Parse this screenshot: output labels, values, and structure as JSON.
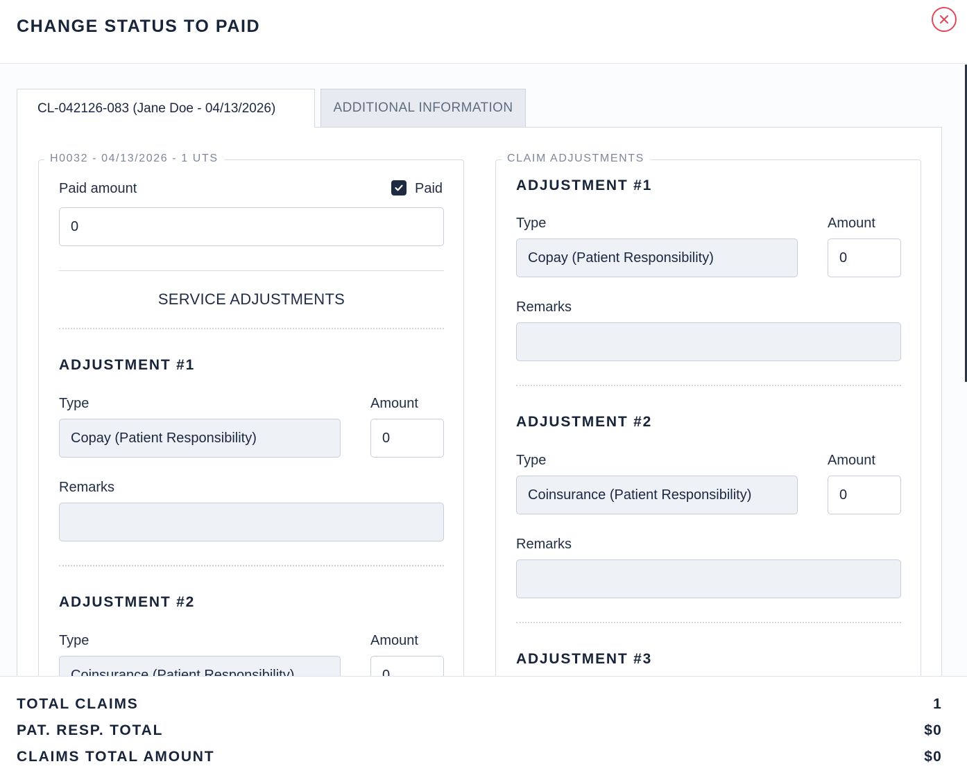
{
  "dialog": {
    "title": "CHANGE STATUS TO PAID"
  },
  "tabs": [
    {
      "label": "CL-042126-083 (Jane Doe - 04/13/2026)",
      "active": true
    },
    {
      "label": "ADDITIONAL INFORMATION",
      "active": false
    }
  ],
  "service": {
    "legend": "H0032 - 04/13/2026 - 1 UTS",
    "paid_amount_label": "Paid amount",
    "paid_amount_value": "0",
    "paid_checkbox_label": "Paid",
    "paid_checked": true,
    "adjustments_heading": "SERVICE ADJUSTMENTS",
    "adjustments": [
      {
        "title": "ADJUSTMENT #1",
        "type_label": "Type",
        "type_value": "Copay (Patient Responsibility)",
        "amount_label": "Amount",
        "amount_value": "0",
        "remarks_label": "Remarks",
        "remarks_value": ""
      },
      {
        "title": "ADJUSTMENT #2",
        "type_label": "Type",
        "type_value": "Coinsurance (Patient Responsibility)",
        "amount_label": "Amount",
        "amount_value": "0"
      }
    ]
  },
  "claim": {
    "legend": "CLAIM ADJUSTMENTS",
    "adjustments": [
      {
        "title": "ADJUSTMENT #1",
        "type_label": "Type",
        "type_value": "Copay (Patient Responsibility)",
        "amount_label": "Amount",
        "amount_value": "0",
        "remarks_label": "Remarks",
        "remarks_value": ""
      },
      {
        "title": "ADJUSTMENT #2",
        "type_label": "Type",
        "type_value": "Coinsurance (Patient Responsibility)",
        "amount_label": "Amount",
        "amount_value": "0",
        "remarks_label": "Remarks",
        "remarks_value": ""
      },
      {
        "title": "ADJUSTMENT #3"
      }
    ]
  },
  "summary": [
    {
      "label": "TOTAL CLAIMS",
      "value": "1"
    },
    {
      "label": "PAT. RESP. TOTAL",
      "value": "$0"
    },
    {
      "label": "CLAIMS TOTAL AMOUNT",
      "value": "$0"
    }
  ],
  "colors": {
    "close_icon": "#e0485a",
    "checkbox_fill": "#1d2a40",
    "grey_input": "#eef1f6"
  },
  "icons": {
    "close": "close-icon",
    "check": "check-icon"
  }
}
